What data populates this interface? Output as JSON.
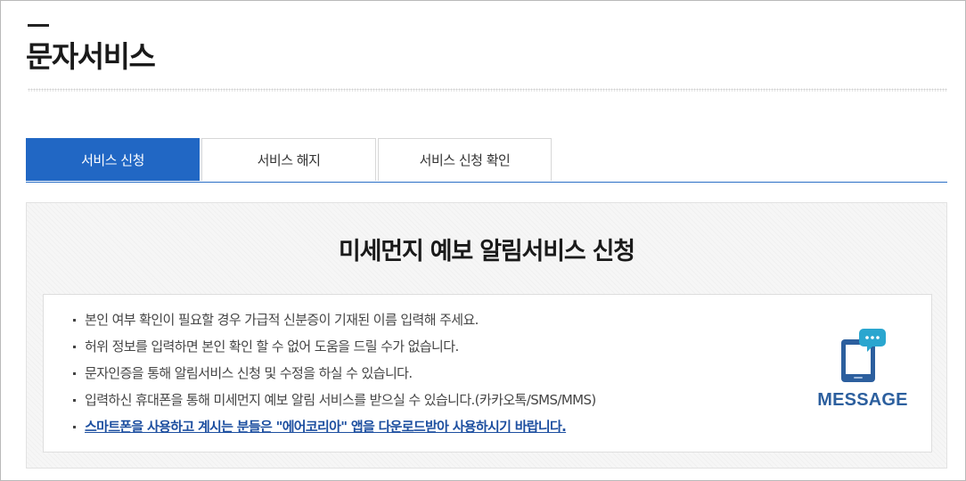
{
  "page": {
    "title": "문자서비스"
  },
  "tabs": [
    {
      "label": "서비스 신청",
      "active": true
    },
    {
      "label": "서비스 해지",
      "active": false
    },
    {
      "label": "서비스 신청 확인",
      "active": false
    }
  ],
  "panel": {
    "heading": "미세먼지 예보 알림서비스 신청",
    "notices": [
      "본인 여부 확인이 필요할 경우 가급적 신분증이 기재된 이름 입력해 주세요.",
      "허위 정보를 입력하면 본인 확인 할 수 없어 도움을 드릴 수가 없습니다.",
      "문자인증을 통해 알림서비스 신청 및 수정을 하실 수 있습니다.",
      "입력하신 휴대폰을 통해 미세먼지 예보 알림 서비스를 받으실 수 있습니다.(카카오톡/SMS/MMS)"
    ],
    "app_link_text": "스마트폰을 사용하고 계시는 분들은 \"에어코리아\" 앱을 다운로드받아 사용하시기 바랍니다.",
    "message_icon": "phone-message-icon",
    "message_label": "MESSAGE"
  },
  "colors": {
    "accent": "#2167c4",
    "link": "#1d4fa0",
    "message_label": "#2c5f9e",
    "bubble": "#2aa6cf"
  }
}
